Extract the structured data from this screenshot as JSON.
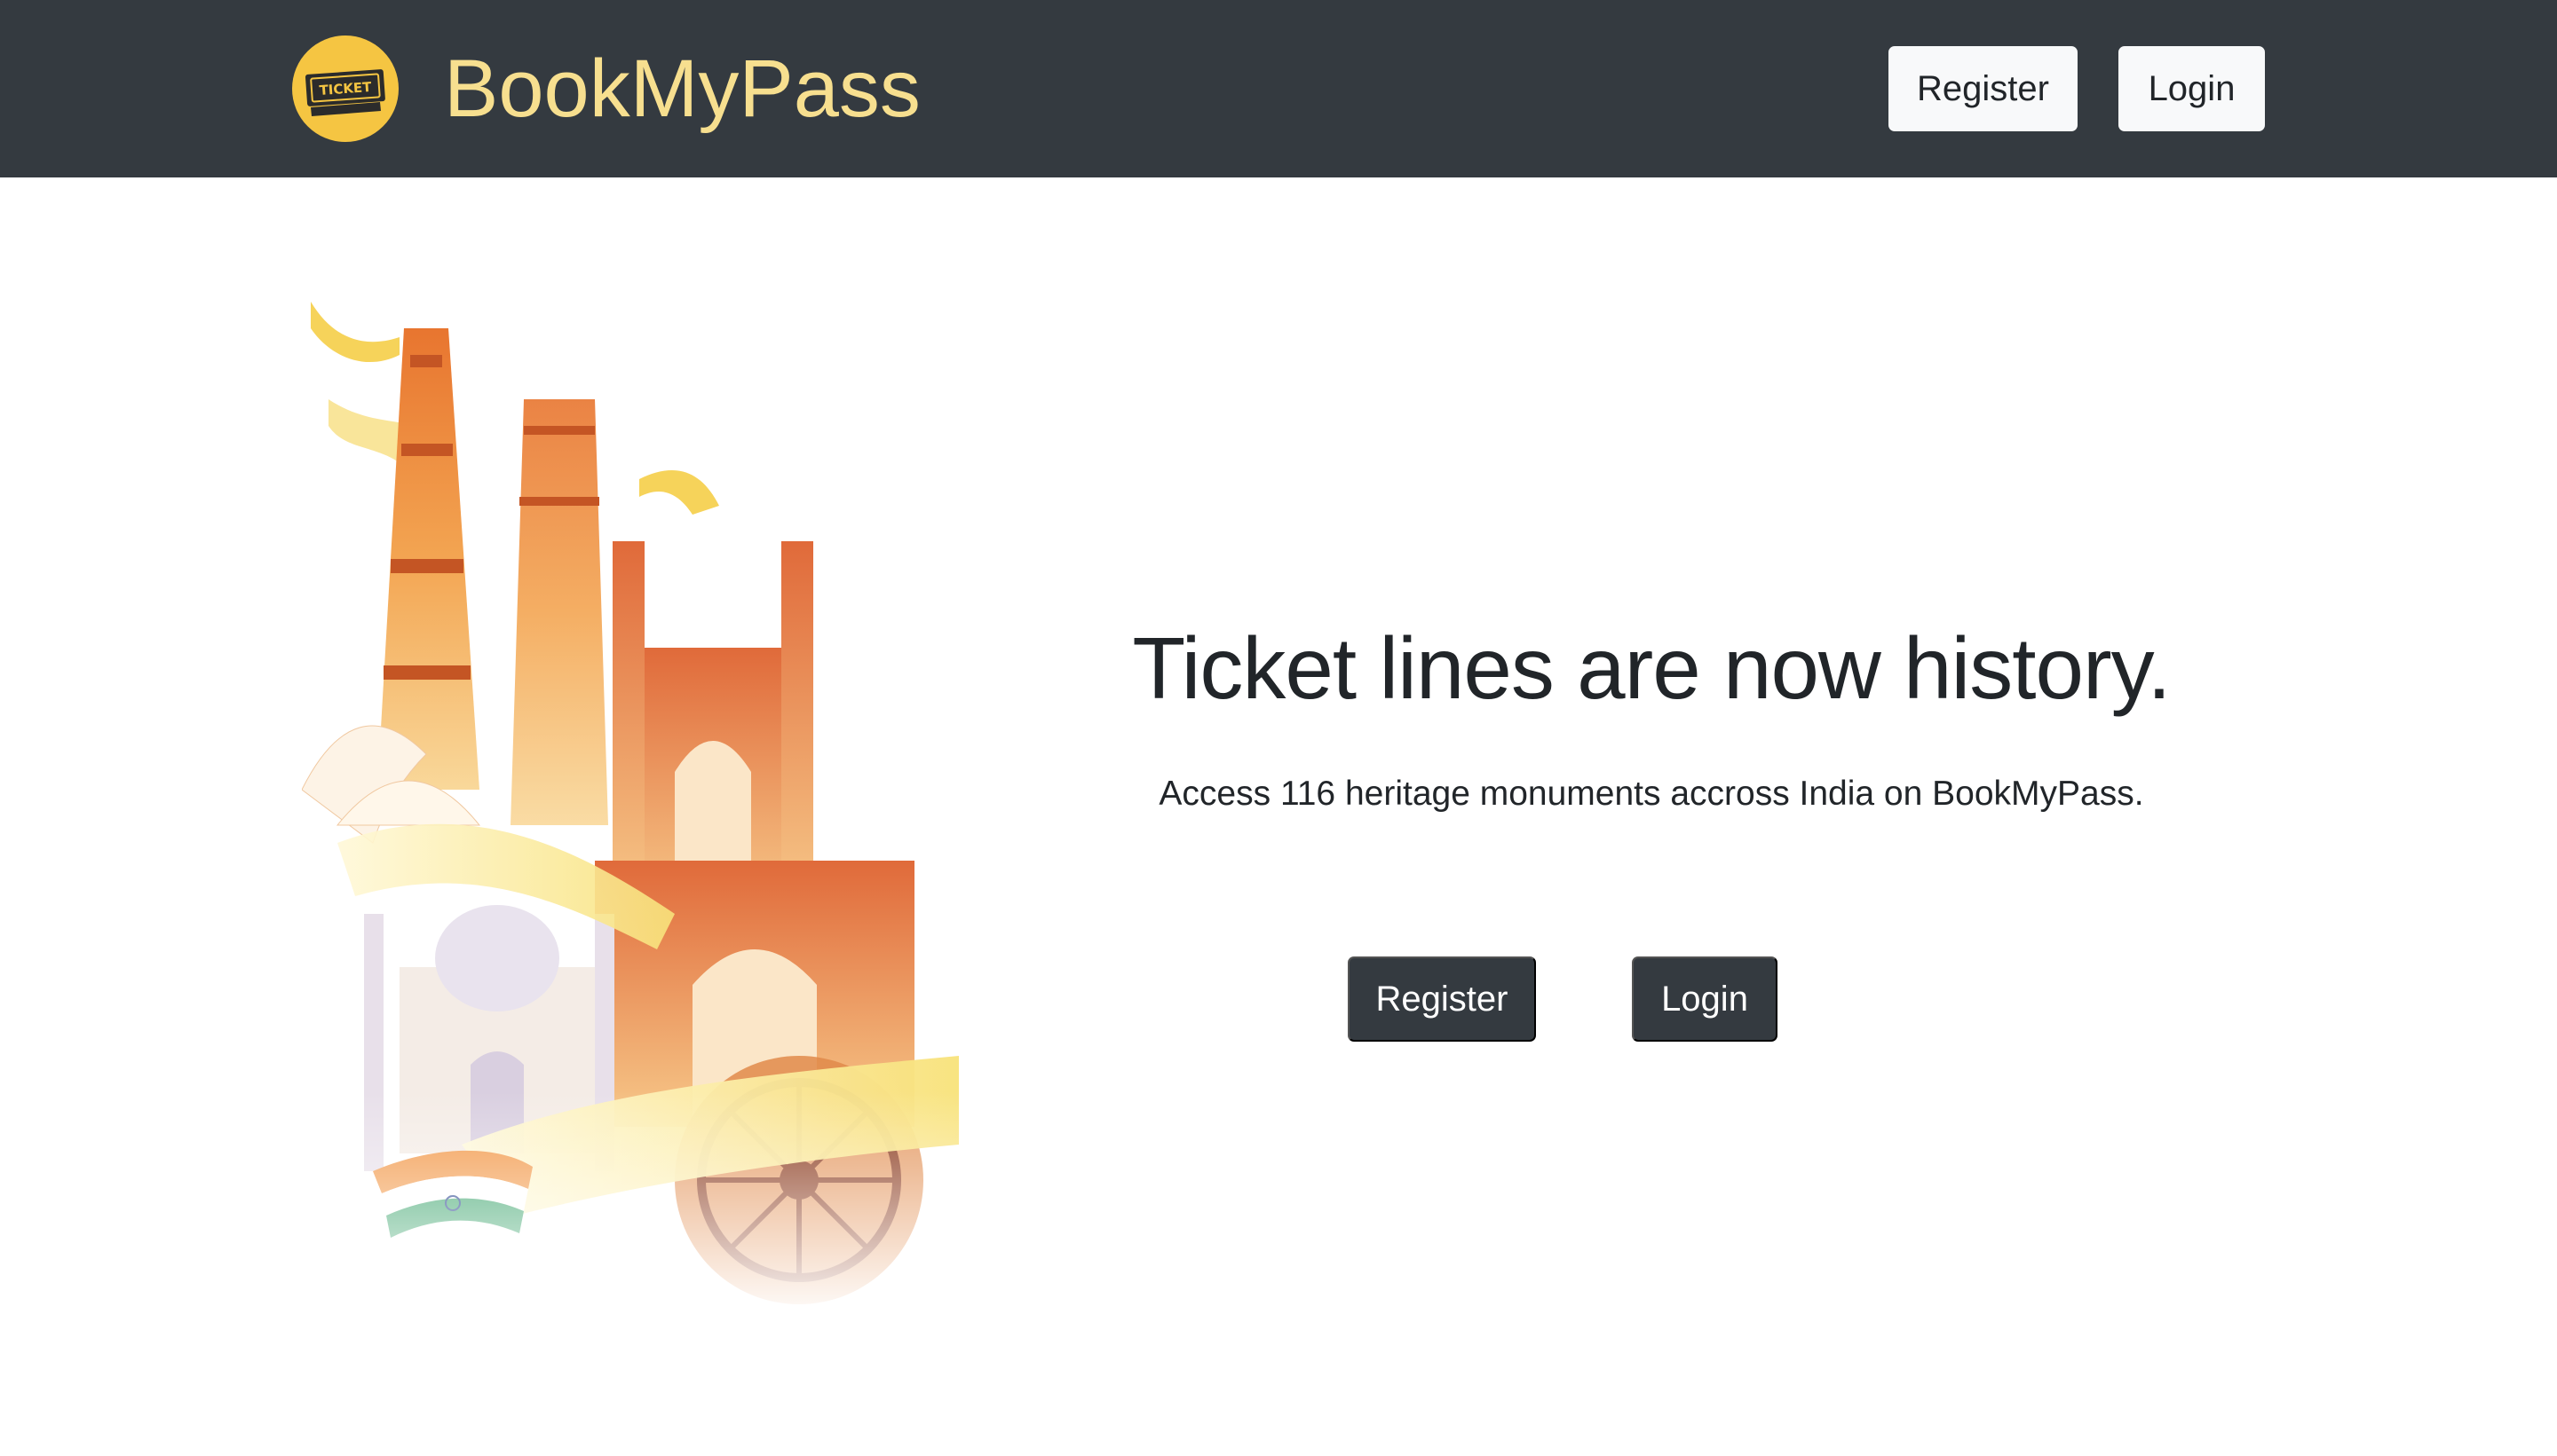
{
  "navbar": {
    "brand_name": "BookMyPass",
    "logo_text": "TICKET",
    "register_label": "Register",
    "login_label": "Login"
  },
  "hero": {
    "title": "Ticket lines are now history.",
    "subtitle": "Access 116 heritage monuments accross India on BookMyPass.",
    "register_label": "Register",
    "login_label": "Login"
  },
  "colors": {
    "navbar_bg": "#343a40",
    "brand_text": "#f7df8f",
    "logo_yellow": "#f5c542",
    "dark_button": "#343a40",
    "light_button": "#f8f9fa",
    "text": "#212529"
  }
}
